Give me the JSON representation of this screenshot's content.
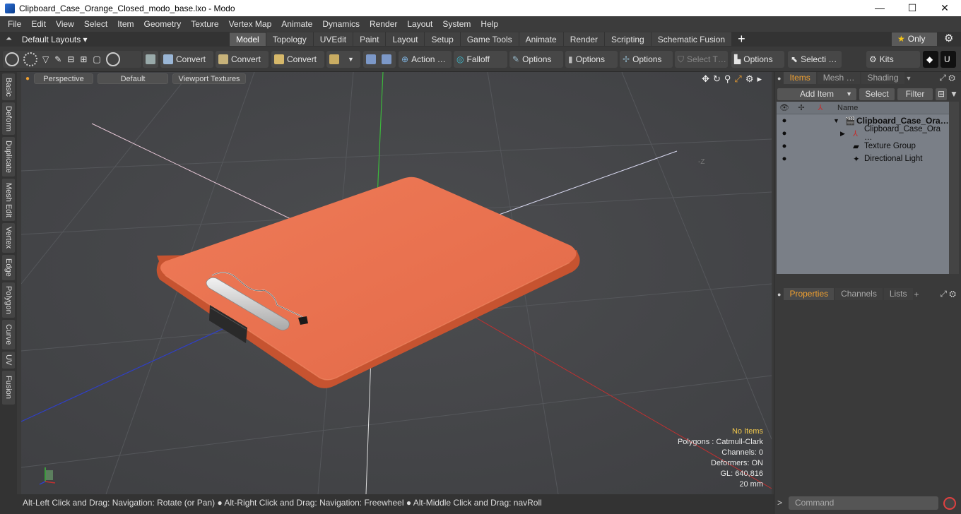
{
  "window": {
    "title": "Clipboard_Case_Orange_Closed_modo_base.lxo - Modo",
    "minimize": "—",
    "maximize": "☐",
    "close": "✕"
  },
  "menu": [
    "File",
    "Edit",
    "View",
    "Select",
    "Item",
    "Geometry",
    "Texture",
    "Vertex Map",
    "Animate",
    "Dynamics",
    "Render",
    "Layout",
    "System",
    "Help"
  ],
  "layoutbar": {
    "layouts_label": "Default Layouts ▾",
    "tabs": [
      "Model",
      "Topology",
      "UVEdit",
      "Paint",
      "Layout",
      "Setup",
      "Game Tools",
      "Animate",
      "Render",
      "Scripting",
      "Schematic Fusion"
    ],
    "active_tab": "Model",
    "only_label": "Only"
  },
  "toolbar": {
    "convert1": "Convert",
    "convert2": "Convert",
    "convert3": "Convert",
    "action": "Action …",
    "falloff": "Falloff",
    "options1": "Options",
    "options2": "Options",
    "options3": "Options",
    "select_t": "Select T…",
    "options4": "Options",
    "selecti": "Selecti …",
    "kits": "Kits"
  },
  "left_tabs": [
    "Basic",
    "Deform",
    "Duplicate",
    "Mesh Edit",
    "Vertex",
    "Edge",
    "Polygon",
    "Curve",
    "UV",
    "Fusion"
  ],
  "viewport": {
    "view_mode": "Perspective",
    "shading": "Default",
    "textures": "Viewport Textures",
    "axis_label": "-Z",
    "info": {
      "selection": "No Items",
      "polygons": "Polygons : Catmull-Clark",
      "channels": "Channels: 0",
      "deformers": "Deformers: ON",
      "gl": "GL: 640,816",
      "scale": "20 mm"
    },
    "colors": {
      "object": "#e8714f",
      "object_shadow": "#c65330",
      "x_axis": "#c03030",
      "y_axis": "#3cb83c",
      "z_axis": "#2f3fc8"
    }
  },
  "status": "Alt-Left Click and Drag: Navigation: Rotate (or Pan) ● Alt-Right Click and Drag: Navigation: Freewheel ● Alt-Middle Click and Drag: navRoll",
  "items_panel": {
    "tabs": [
      "Items",
      "Mesh …",
      "Shading"
    ],
    "add_item": "Add Item",
    "select": "Select",
    "filter": "Filter",
    "column_name": "Name",
    "rows": [
      {
        "label": "Clipboard_Case_Ora…"
      },
      {
        "label": "Clipboard_Case_Ora …"
      },
      {
        "label": "Texture Group"
      },
      {
        "label": "Directional Light"
      }
    ]
  },
  "props_panel": {
    "tabs": [
      "Properties",
      "Channels",
      "Lists"
    ]
  },
  "command": {
    "prompt": ">",
    "placeholder": "Command"
  }
}
